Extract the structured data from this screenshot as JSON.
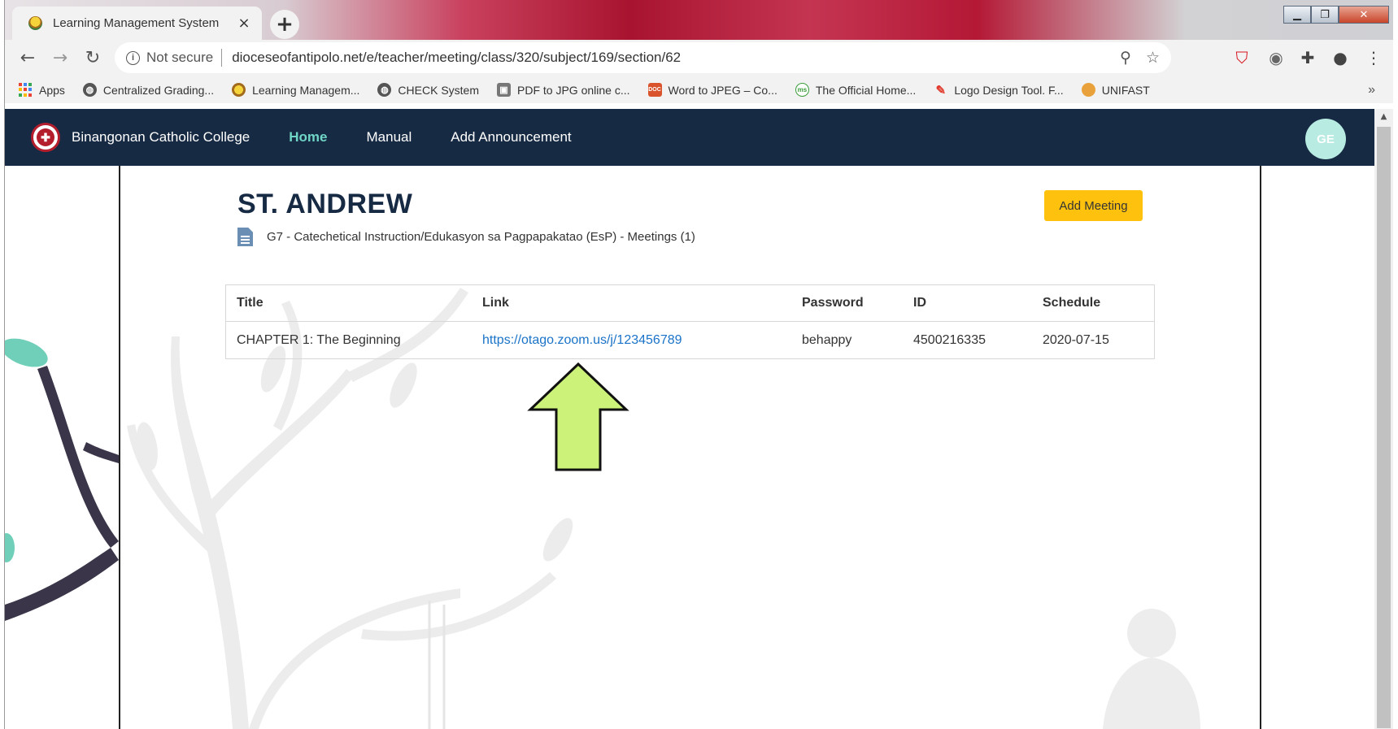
{
  "browser": {
    "tab_title": "Learning Management System",
    "tab_close": "×",
    "new_tab": "+",
    "not_secure": "Not secure",
    "url": "dioceseofantipolo.net/e/teacher/meeting/class/320/subject/169/section/62"
  },
  "bookmarks": [
    {
      "label": "Apps",
      "icon": "apps-grid-icon"
    },
    {
      "label": "Centralized Grading...",
      "icon": "globe-icon"
    },
    {
      "label": "Learning Managem...",
      "icon": "school-seal-icon"
    },
    {
      "label": "CHECK System",
      "icon": "globe-icon"
    },
    {
      "label": "PDF to JPG online c...",
      "icon": "pdf-icon"
    },
    {
      "label": "Word to JPEG – Co...",
      "icon": "doc-jpg-icon"
    },
    {
      "label": "The Official Home...",
      "icon": "ms-icon"
    },
    {
      "label": "Logo Design Tool. F...",
      "icon": "pen-icon"
    },
    {
      "label": "UNIFAST",
      "icon": "unifast-icon"
    }
  ],
  "site": {
    "brand": "Binangonan Catholic College",
    "nav": [
      "Home",
      "Manual",
      "Add Announcement"
    ],
    "active_nav": "Home",
    "avatar_initials": "GE",
    "accent": "#172a44"
  },
  "page": {
    "title": "ST. ANDREW",
    "subtitle": "G7 - Catechetical Instruction/Edukasyon sa Pagpapakatao (EsP) - Meetings (1)",
    "add_button": "Add Meeting"
  },
  "table": {
    "headers": [
      "Title",
      "Link",
      "Password",
      "ID",
      "Schedule"
    ],
    "rows": [
      [
        "CHAPTER 1: The Beginning",
        "https://otago.zoom.us/j/123456789",
        "behappy",
        "4500216335",
        "2020-07-15"
      ]
    ]
  },
  "annotation": {
    "arrow_color": "#ccf27a"
  }
}
